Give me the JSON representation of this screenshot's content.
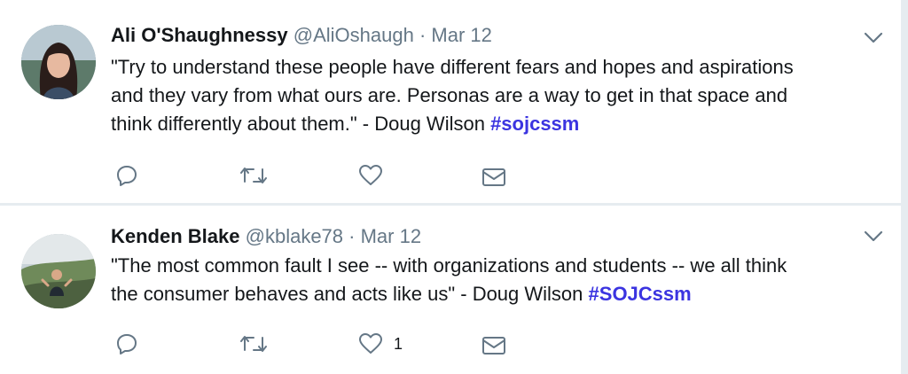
{
  "tweets": [
    {
      "name": "Ali O'Shaughnessy",
      "handle": "@AliOshaugh",
      "separator": "·",
      "date": "Mar 12",
      "text_lines": [
        "\"Try to understand these people have different fears and hopes and aspirations",
        "and they vary from what ours are. Personas are a way to get in that space and",
        "think differently about them.\" - Doug Wilson "
      ],
      "hashtag": "#sojcssm",
      "like_count": ""
    },
    {
      "name": "Kenden Blake",
      "handle": "@kblake78",
      "separator": "·",
      "date": "Mar 12",
      "text_lines": [
        "\"The most common fault I see -- with organizations and students -- we all think",
        "the consumer behaves and acts like us\" - Doug Wilson "
      ],
      "hashtag": "#SOJCssm",
      "like_count": "1"
    }
  ],
  "icons": {
    "reply": "reply-icon",
    "retweet": "retweet-icon",
    "like": "heart-icon",
    "dm": "envelope-icon",
    "more": "chevron-down-icon"
  },
  "colors": {
    "text": "#14171a",
    "secondary": "#657786",
    "hashtag": "#3b34e0",
    "background": "#e6ecf0",
    "card": "#ffffff"
  }
}
